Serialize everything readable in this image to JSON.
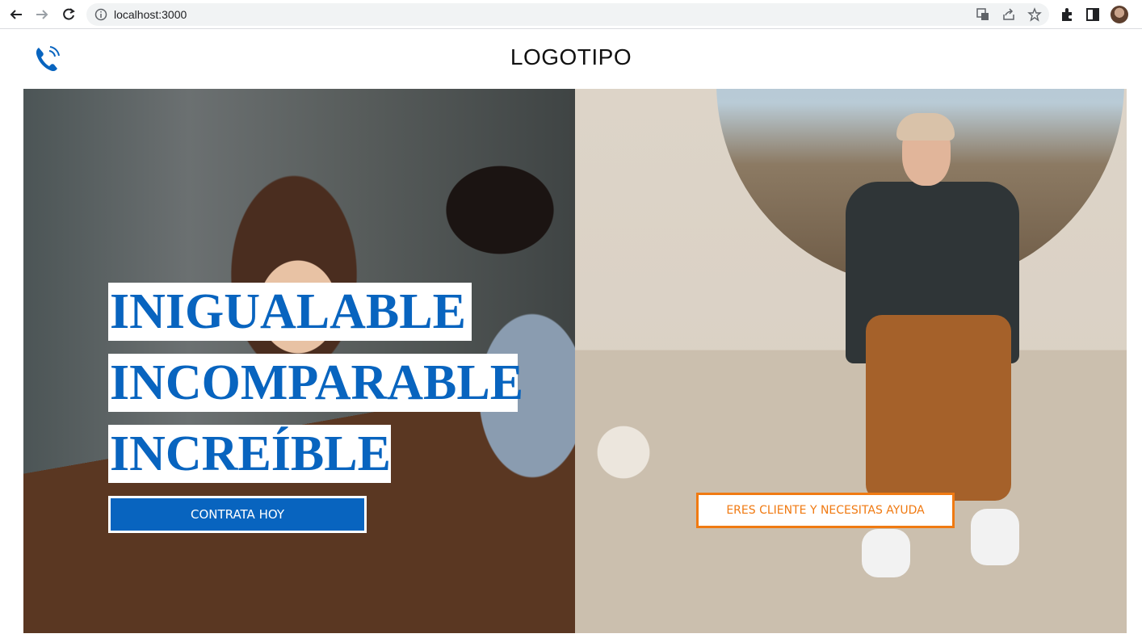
{
  "browser": {
    "url": "localhost:3000",
    "icons": [
      "back-icon",
      "forward-icon",
      "reload-icon",
      "info-icon",
      "translate-icon",
      "share-icon",
      "star-icon",
      "extensions-icon",
      "sidepanel-icon",
      "profile-avatar"
    ]
  },
  "header": {
    "logo": "LOGOTIPO",
    "phone_icon": "phone-icon"
  },
  "hero": {
    "headline_lines": [
      "INIGUALABLE",
      "INCOMPARABLE",
      "INCREÍBLE"
    ],
    "primary_cta": "CONTRATA HOY",
    "secondary_cta": "ERES CLIENTE Y NECESITAS AYUDA"
  },
  "colors": {
    "brand_blue": "#0864bf",
    "accent_orange": "#f07a12"
  }
}
